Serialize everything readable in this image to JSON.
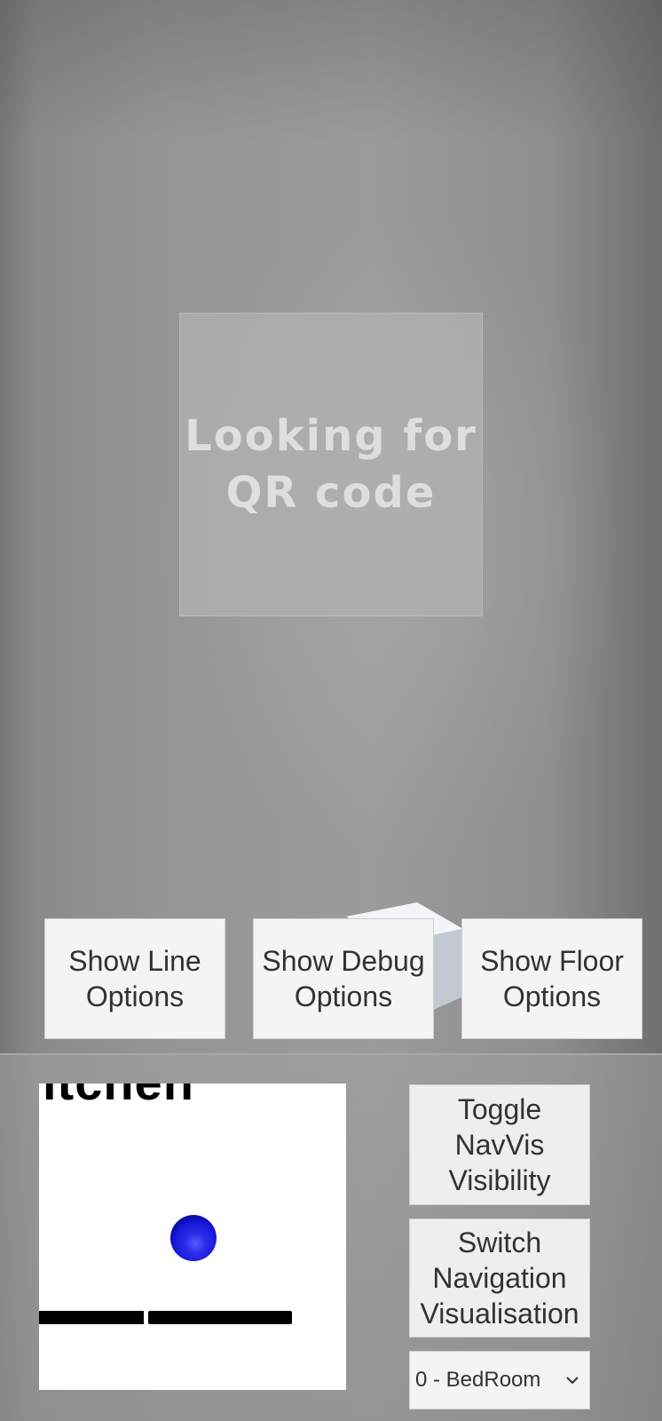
{
  "status": {
    "scan_message": "Looking for\nQR code"
  },
  "option_buttons": {
    "line": "Show Line\nOptions",
    "debug": "Show Debug\nOptions",
    "floor": "Show Floor\nOptions"
  },
  "minimap": {
    "room_label": "itchen",
    "player_color": "#1a1ae0"
  },
  "navigation": {
    "toggle_label": "Toggle\nNavVis\nVisibility",
    "switch_label": "Switch\nNavigation\nVisualisation",
    "floor_select": {
      "selected": "0 - BedRoom"
    }
  },
  "icons": {
    "dropdown": "chevron-down-icon",
    "cube": "cube-icon"
  }
}
